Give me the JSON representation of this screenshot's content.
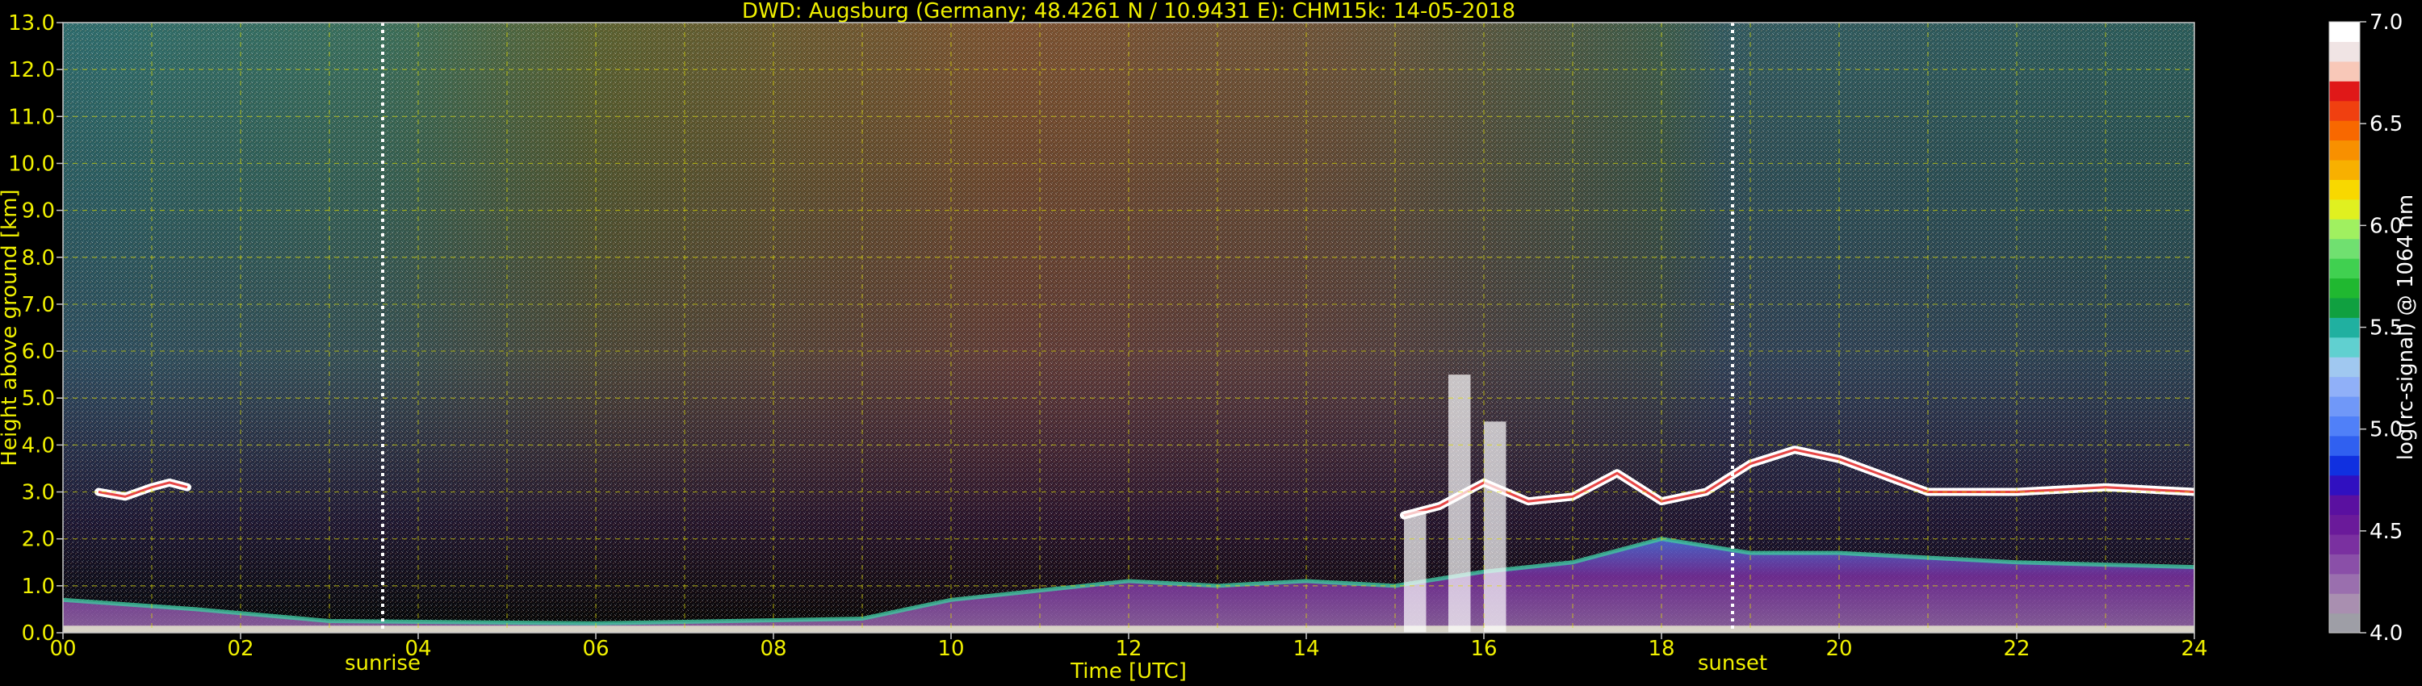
{
  "chart_data": {
    "type": "heatmap",
    "title": "DWD: Augsburg (Germany; 48.4261 N / 10.9431 E):    CHM15k: 14-05-2018",
    "xlabel": "Time [UTC]",
    "ylabel": "Height above ground [km]",
    "x_ticks": [
      "00",
      "02",
      "04",
      "06",
      "08",
      "10",
      "12",
      "14",
      "16",
      "18",
      "20",
      "22",
      "24"
    ],
    "y_ticks": [
      "0.0",
      "1.0",
      "2.0",
      "3.0",
      "4.0",
      "5.0",
      "6.0",
      "7.0",
      "8.0",
      "9.0",
      "10.0",
      "11.0",
      "12.0",
      "13.0"
    ],
    "xlim": [
      0,
      24
    ],
    "ylim": [
      0,
      13
    ],
    "grid": true,
    "colorbar": {
      "label": "log(rc-signal) @ 1064 nm",
      "range": [
        4.0,
        7.0
      ],
      "ticks": [
        "4.0",
        "4.5",
        "5.0",
        "5.5",
        "6.0",
        "6.5",
        "7.0"
      ],
      "colors": [
        "#9e9ea6",
        "#a98fb0",
        "#9a6fae",
        "#8a4fa8",
        "#7a30a0",
        "#6a1a9a",
        "#5a10a0",
        "#3010c0",
        "#1030e0",
        "#3060f0",
        "#5080f8",
        "#7098f8",
        "#90b0f8",
        "#a0c8f0",
        "#60d0d0",
        "#20b0a0",
        "#10a040",
        "#20b830",
        "#40d050",
        "#70e070",
        "#a0f060",
        "#e0f020",
        "#f8d800",
        "#f8b000",
        "#f89000",
        "#f86800",
        "#f04010",
        "#e01818",
        "#f8c8b8",
        "#f0e4e4",
        "#ffffff"
      ]
    },
    "markers": [
      {
        "label": "sunrise",
        "time": 3.6
      },
      {
        "label": "sunset",
        "time": 18.8
      }
    ],
    "layers": [
      {
        "name": "boundary-layer",
        "points": [
          [
            0,
            0.7
          ],
          [
            1.5,
            0.5
          ],
          [
            3,
            0.25
          ],
          [
            6,
            0.2
          ],
          [
            9,
            0.3
          ],
          [
            10,
            0.7
          ],
          [
            11,
            0.9
          ],
          [
            12,
            1.1
          ],
          [
            13,
            1.0
          ],
          [
            14,
            1.1
          ],
          [
            15,
            1.0
          ],
          [
            16,
            1.3
          ],
          [
            17,
            1.5
          ],
          [
            18,
            2.0
          ],
          [
            19,
            1.7
          ],
          [
            20,
            1.7
          ],
          [
            22,
            1.5
          ],
          [
            24,
            1.4
          ]
        ]
      },
      {
        "name": "cloud-layer-early",
        "points": [
          [
            0.4,
            3.0
          ],
          [
            0.7,
            2.9
          ],
          [
            1.0,
            3.1
          ],
          [
            1.2,
            3.2
          ],
          [
            1.4,
            3.1
          ]
        ]
      },
      {
        "name": "cloud-layer-late",
        "points": [
          [
            15.1,
            2.5
          ],
          [
            15.5,
            2.7
          ],
          [
            16,
            3.2
          ],
          [
            16.5,
            2.8
          ],
          [
            17,
            2.9
          ],
          [
            17.5,
            3.4
          ],
          [
            18,
            2.8
          ],
          [
            18.5,
            3.0
          ],
          [
            19,
            3.6
          ],
          [
            19.5,
            3.9
          ],
          [
            20,
            3.7
          ],
          [
            21,
            3.0
          ],
          [
            22,
            3.0
          ],
          [
            23,
            3.1
          ],
          [
            24,
            3.0
          ]
        ]
      }
    ]
  }
}
